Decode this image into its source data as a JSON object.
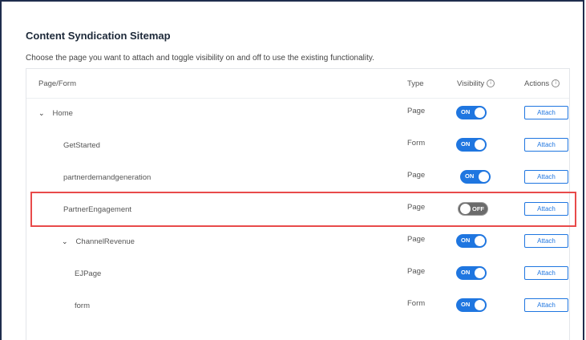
{
  "page": {
    "title": "Content Syndication Sitemap",
    "subtitle": "Choose the page you want to attach and toggle visibility on and off to use the existing functionality."
  },
  "table": {
    "headers": {
      "page_form": "Page/Form",
      "type": "Type",
      "visibility": "Visibility",
      "actions": "Actions"
    },
    "info_icon_glyph": "i",
    "chevron_glyph": "⌄",
    "rows": [
      {
        "name": "Home",
        "type": "Page",
        "visibility_label": "ON",
        "visibility_on": true,
        "action": "Attach",
        "expandable": true
      },
      {
        "name": "GetStarted",
        "type": "Form",
        "visibility_label": "ON",
        "visibility_on": true,
        "action": "Attach",
        "expandable": false
      },
      {
        "name": "partnerdemandgeneration",
        "type": "Page",
        "visibility_label": "ON",
        "visibility_on": true,
        "action": "Attach",
        "expandable": false
      },
      {
        "name": "PartnerEngagement",
        "type": "Page",
        "visibility_label": "OFF",
        "visibility_on": false,
        "action": "Attach",
        "expandable": false
      },
      {
        "name": "ChannelRevenue",
        "type": "Page",
        "visibility_label": "ON",
        "visibility_on": true,
        "action": "Attach",
        "expandable": true
      },
      {
        "name": "EJPage",
        "type": "Page",
        "visibility_label": "ON",
        "visibility_on": true,
        "action": "Attach",
        "expandable": false
      },
      {
        "name": "form",
        "type": "Form",
        "visibility_label": "ON",
        "visibility_on": true,
        "action": "Attach",
        "expandable": false
      }
    ]
  },
  "colors": {
    "toggle_on": "#1f76e0",
    "toggle_off": "#6b6b6b",
    "highlight": "#e84a4a"
  }
}
